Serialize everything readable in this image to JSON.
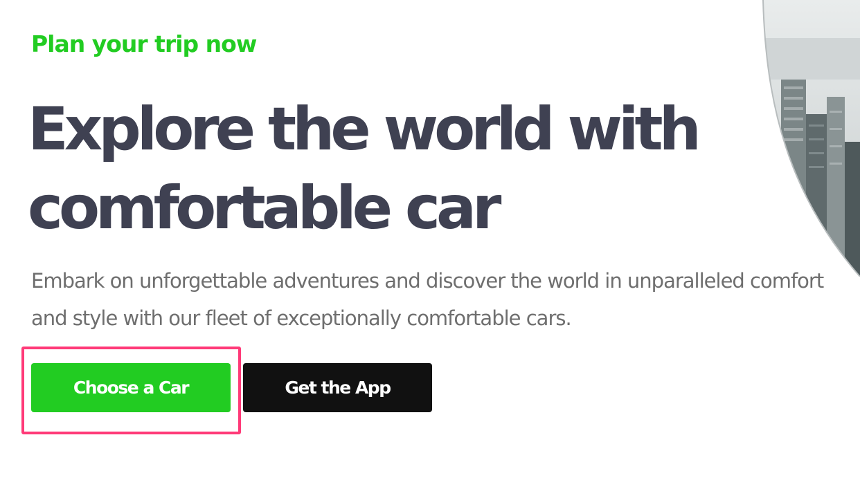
{
  "hero": {
    "eyebrow": "Plan your trip now",
    "headline_line1": "Explore the world with",
    "headline_line2": "comfortable car",
    "description": "Embark on unforgettable adventures and discover the world in unparalleled comfort and style with our fleet of exceptionally comfortable cars."
  },
  "buttons": {
    "primary_label": "Choose a Car",
    "secondary_label": "Get the App"
  },
  "colors": {
    "accent": "#22cc22",
    "headline": "#3f4152",
    "body_text": "#6e6e6e",
    "secondary_button": "#111111",
    "highlight": "#ff3a78"
  }
}
